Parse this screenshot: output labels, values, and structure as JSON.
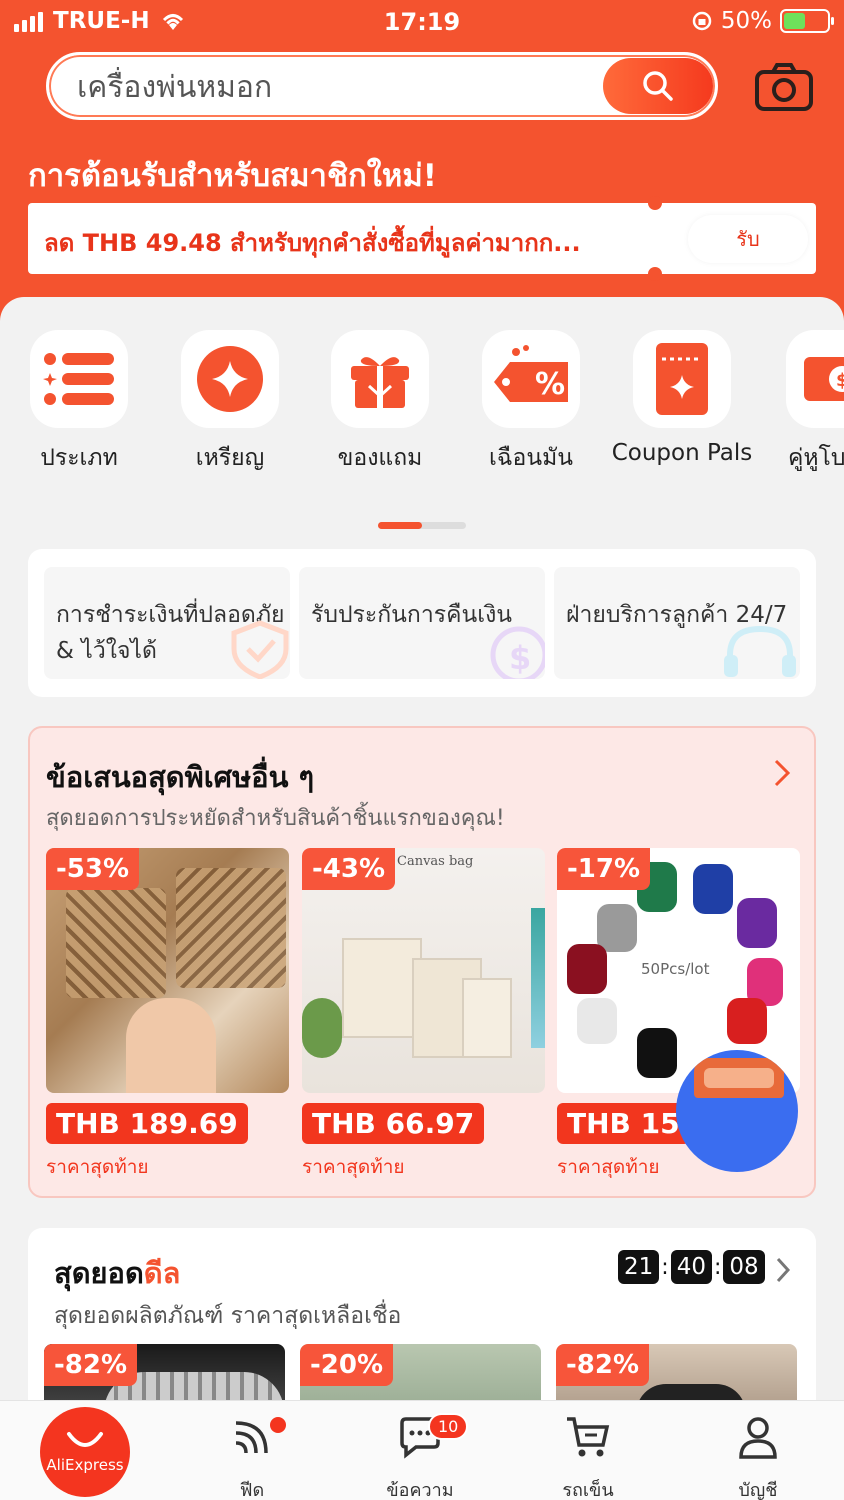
{
  "status": {
    "carrier": "TRUE-H",
    "time": "17:19",
    "battery": "50%"
  },
  "search": {
    "value": "เครื่องพ่นหมอก"
  },
  "promo": {
    "title": "การต้อนรับสำหรับสมาชิกใหม่!",
    "coupon_text": "ลด THB 49.48 สำหรับทุกคำสั่งซื้อที่มูลค่ามากก...",
    "claim_label": "รับ"
  },
  "categories": [
    {
      "label": "ประเภท",
      "icon": "list-icon"
    },
    {
      "label": "เหรียญ",
      "icon": "coin-icon"
    },
    {
      "label": "ของแถม",
      "icon": "gift-icon"
    },
    {
      "label": "เฉือนมัน",
      "icon": "discount-tag-icon"
    },
    {
      "label": "Coupon Pals",
      "icon": "coupon-pals-icon"
    },
    {
      "label": "คู่หูโบ",
      "icon": "coupon-ticket-icon"
    }
  ],
  "pager": {
    "active": 1,
    "total": 2
  },
  "assurances": [
    {
      "label": "การชำระเงินที่ปลอดภัย & ไว้ใจได้",
      "icon": "shield-check-icon"
    },
    {
      "label": "รับประกันการคืนเงิน",
      "icon": "money-back-icon"
    },
    {
      "label": "ฝ่ายบริการลูกค้า 24/7",
      "icon": "headset-icon"
    }
  ],
  "offers": {
    "title": "ข้อเสนอสุดพิเศษอื่น ๆ",
    "subtitle": "สุดยอดการประหยัดสำหรับสินค้าชิ้นแรกของคุณ!",
    "products": [
      {
        "discount": "-53%",
        "price": "THB 189.69",
        "note": "ราคาสุดท้าย",
        "img_label": ""
      },
      {
        "discount": "-43%",
        "price": "THB 66.97",
        "note": "ราคาสุดท้าย",
        "img_label": "Canvas bag"
      },
      {
        "discount": "-17%",
        "price": "THB 15",
        "note": "ราคาสุดท้าย",
        "img_label": "50Pcs/lot"
      }
    ]
  },
  "deals": {
    "title_a": "สุดยอด",
    "title_b": "ดีล",
    "subtitle": "สุดยอดผลิตภัณฑ์ ราคาสุดเหลือเชื่อ",
    "timer": {
      "h": "21",
      "m": "40",
      "s": "08"
    },
    "products": [
      {
        "discount": "-82%"
      },
      {
        "discount": "-20%"
      },
      {
        "discount": "-82%"
      }
    ]
  },
  "tabbar": {
    "home_label": "AliExpress",
    "feed_label": "ฟีด",
    "messages_label": "ข้อความ",
    "messages_badge": "10",
    "cart_label": "รถเข็น",
    "account_label": "บัญชี"
  },
  "colors": {
    "brand": "#f4532f",
    "price": "#f2361e",
    "offers_bg": "#fde8e6"
  }
}
